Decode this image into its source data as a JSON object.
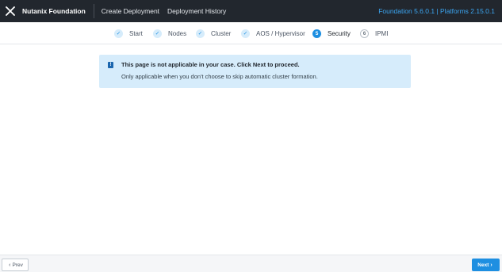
{
  "header": {
    "app_title": "Nutanix Foundation",
    "nav": [
      "Create Deployment",
      "Deployment History"
    ],
    "version": "Foundation 5.6.0.1 | Platforms 2.15.0.1"
  },
  "stepper": {
    "steps": [
      {
        "label": "Start",
        "state": "done",
        "marker": "✓"
      },
      {
        "label": "Nodes",
        "state": "done",
        "marker": "✓"
      },
      {
        "label": "Cluster",
        "state": "done",
        "marker": "✓"
      },
      {
        "label": "AOS / Hypervisor",
        "state": "done",
        "marker": "✓"
      },
      {
        "label": "Security",
        "state": "active",
        "marker": "5"
      },
      {
        "label": "IPMI",
        "state": "todo",
        "marker": "6"
      }
    ]
  },
  "notice": {
    "icon": "!",
    "title": "This page is not applicable in your case. Click Next to proceed.",
    "text": "Only applicable when you don't choose to skip automatic cluster formation."
  },
  "footer": {
    "prev_label": "Prev",
    "next_label": "Next"
  },
  "colors": {
    "topbar": "#22272e",
    "accent": "#1e8fe1",
    "version_text": "#3ba6f2",
    "notice_bg": "#d6ecfb"
  }
}
